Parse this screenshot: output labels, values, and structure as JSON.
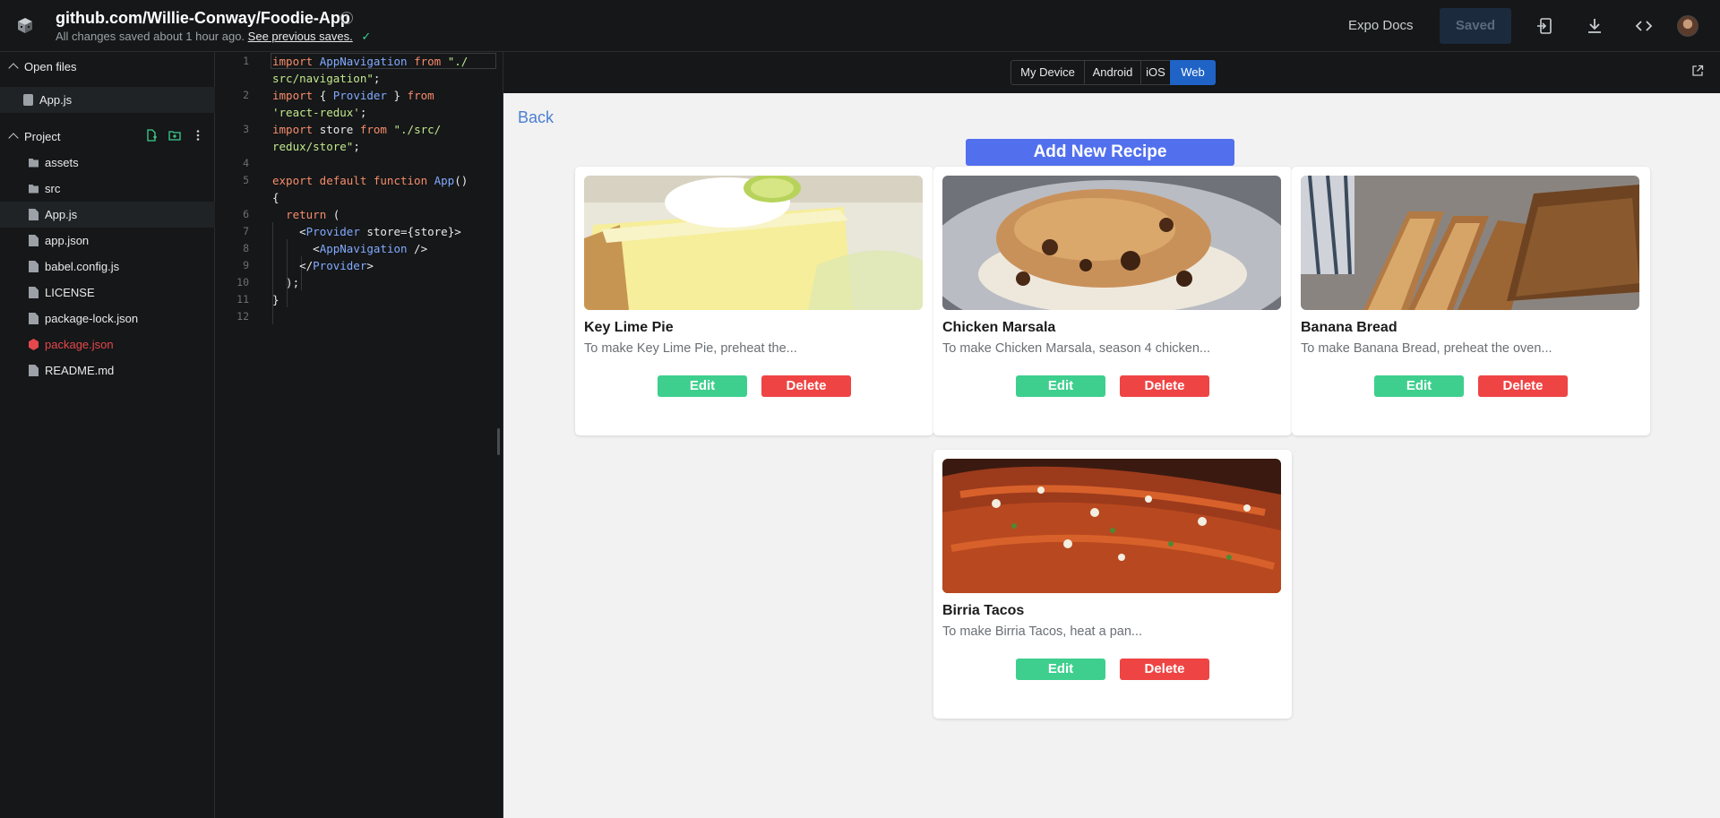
{
  "header": {
    "title": "github.com/Willie-Conway/Foodie-App",
    "subtitle_text": "All changes saved about 1 hour ago.",
    "subtitle_link": "See previous saves.",
    "info_glyph": "i",
    "expo_docs": "Expo Docs",
    "saved_label": "Saved"
  },
  "sidebar": {
    "open_files_label": "Open files",
    "open_files": [
      "App.js"
    ],
    "project_label": "Project",
    "files": [
      {
        "label": "assets",
        "icon": "folder-icon"
      },
      {
        "label": "src",
        "icon": "folder-icon"
      },
      {
        "label": "App.js",
        "icon": "js-file-icon",
        "active": true
      },
      {
        "label": "app.json",
        "icon": "file-icon"
      },
      {
        "label": "babel.config.js",
        "icon": "file-icon"
      },
      {
        "label": "LICENSE",
        "icon": "file-icon"
      },
      {
        "label": "package-lock.json",
        "icon": "file-icon"
      },
      {
        "label": "package.json",
        "icon": "package-icon",
        "color": "#e5484d"
      },
      {
        "label": "README.md",
        "icon": "file-icon"
      }
    ]
  },
  "editor": {
    "line_numbers": [
      "1",
      "2",
      "3",
      "4",
      "5",
      "6",
      "7",
      "8",
      "9",
      "10",
      "11",
      "12"
    ]
  },
  "preview_toolbar": {
    "tabs": [
      "My Device",
      "Android",
      "iOS",
      "Web"
    ],
    "active_tab": "Web"
  },
  "app": {
    "back_label": "Back",
    "add_button": "Add New Recipe",
    "recipes": [
      {
        "name": "Key Lime Pie",
        "description": "To make Key Lime Pie, preheat the...",
        "edit": "Edit",
        "delete": "Delete"
      },
      {
        "name": "Chicken Marsala",
        "description": "To make Chicken Marsala, season 4 chicken...",
        "edit": "Edit",
        "delete": "Delete"
      },
      {
        "name": "Banana Bread",
        "description": "To make Banana Bread, preheat the oven...",
        "edit": "Edit",
        "delete": "Delete"
      },
      {
        "name": "Birria Tacos",
        "description": "To make Birria Tacos, heat a pan...",
        "edit": "Edit",
        "delete": "Delete"
      }
    ]
  },
  "colors": {
    "accent_blue": "#5270ee",
    "edit_green": "#3ecf8e",
    "delete_red": "#ef4444",
    "active_tab": "#1f63c7"
  }
}
